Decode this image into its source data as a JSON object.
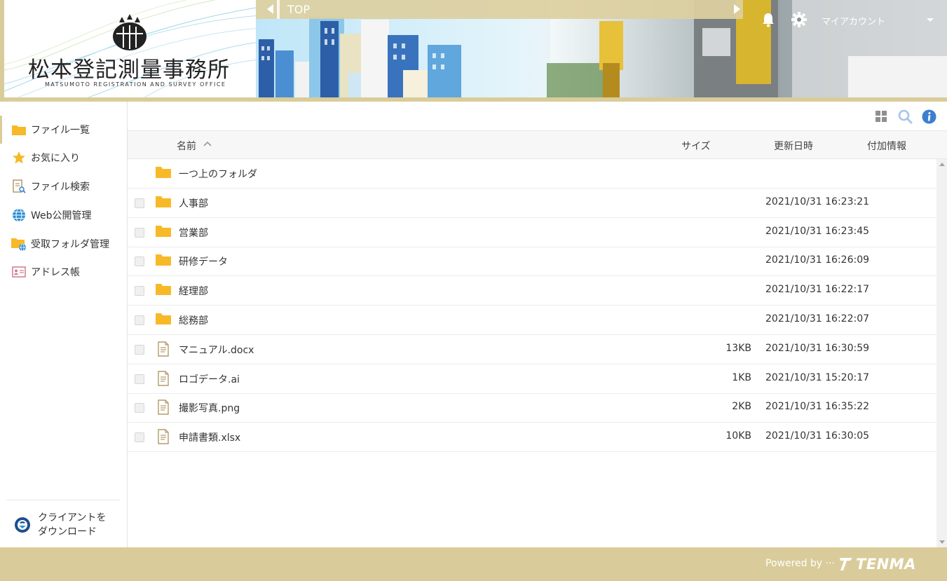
{
  "header": {
    "logo_text": "松本登記測量事務所",
    "logo_subtext": "MATSUMOTO REGISTRATION AND SURVEY OFFICE",
    "breadcrumb_title": "TOP",
    "account_label": "マイアカウント"
  },
  "sidebar": {
    "items": [
      {
        "label": "ファイル一覧",
        "icon": "folder-icon"
      },
      {
        "label": "お気に入り",
        "icon": "star-icon"
      },
      {
        "label": "ファイル検索",
        "icon": "file-search-icon"
      },
      {
        "label": "Web公開管理",
        "icon": "globe-icon"
      },
      {
        "label": "受取フォルダ管理",
        "icon": "receive-folder-icon"
      },
      {
        "label": "アドレス帳",
        "icon": "address-book-icon"
      }
    ],
    "client_download_line1": "クライアントを",
    "client_download_line2": "ダウンロード"
  },
  "table": {
    "columns": {
      "name": "名前",
      "size": "サイズ",
      "updated": "更新日時",
      "extra": "付加情報"
    },
    "parent_folder": "一つ上のフォルダ",
    "rows": [
      {
        "name": "人事部",
        "size": "",
        "updated": "2021/10/31 16:23:21",
        "type": "folder"
      },
      {
        "name": "営業部",
        "size": "",
        "updated": "2021/10/31 16:23:45",
        "type": "folder"
      },
      {
        "name": "研修データ",
        "size": "",
        "updated": "2021/10/31 16:26:09",
        "type": "folder"
      },
      {
        "name": "経理部",
        "size": "",
        "updated": "2021/10/31 16:22:17",
        "type": "folder"
      },
      {
        "name": "総務部",
        "size": "",
        "updated": "2021/10/31 16:22:07",
        "type": "folder"
      },
      {
        "name": "マニュアル.docx",
        "size": "13KB",
        "updated": "2021/10/31 16:30:59",
        "type": "file"
      },
      {
        "name": "ロゴデータ.ai",
        "size": "1KB",
        "updated": "2021/10/31 15:20:17",
        "type": "file"
      },
      {
        "name": "撮影写真.png",
        "size": "2KB",
        "updated": "2021/10/31 16:35:22",
        "type": "file"
      },
      {
        "name": "申請書類.xlsx",
        "size": "10KB",
        "updated": "2021/10/31 16:30:05",
        "type": "file"
      }
    ]
  },
  "footer": {
    "powered_by": "Powered by ···",
    "brand": "TENMA"
  },
  "colors": {
    "accent": "#d9cc9a",
    "folder": "#f7b928",
    "info_blue": "#3b7fd0"
  }
}
